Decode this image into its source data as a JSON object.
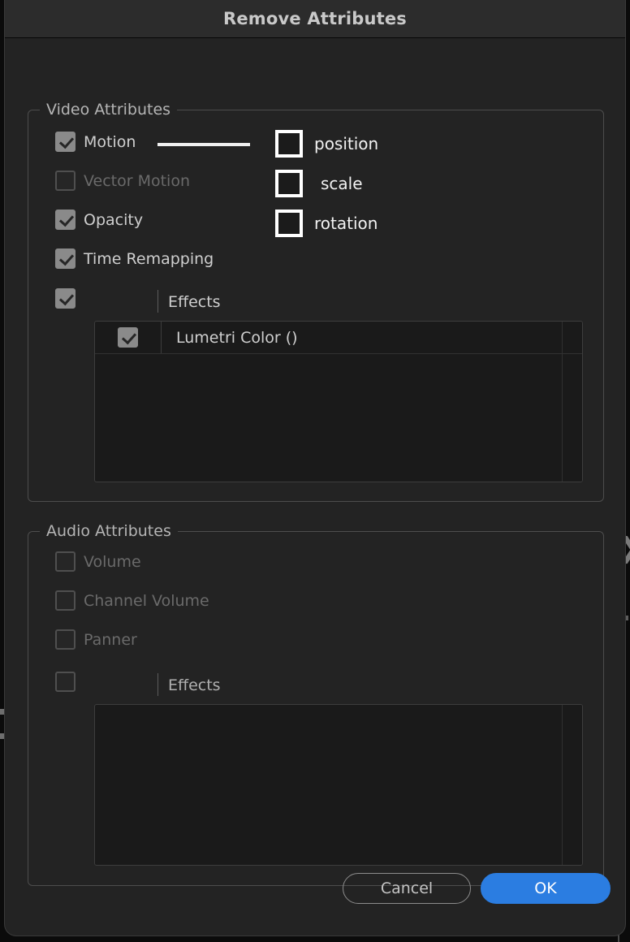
{
  "window": {
    "title": "Remove Attributes"
  },
  "video_group": {
    "legend": "Video Attributes",
    "attributes": [
      {
        "label": "Motion",
        "state": "checked",
        "enabled": true
      },
      {
        "label": "Vector Motion",
        "state": "unchecked",
        "enabled": false
      },
      {
        "label": "Opacity",
        "state": "checked",
        "enabled": true
      },
      {
        "label": "Time Remapping",
        "state": "checked",
        "enabled": true
      }
    ],
    "motion_options": [
      {
        "label": "position",
        "state": "unchecked"
      },
      {
        "label": "scale",
        "state": "unchecked"
      },
      {
        "label": "rotation",
        "state": "unchecked"
      }
    ],
    "effects": {
      "label": "Effects",
      "state": "checked",
      "items": [
        {
          "label": "Lumetri Color ()",
          "state": "checked"
        }
      ]
    }
  },
  "audio_group": {
    "legend": "Audio Attributes",
    "attributes": [
      {
        "label": "Volume",
        "state": "unchecked",
        "enabled": false
      },
      {
        "label": "Channel Volume",
        "state": "unchecked",
        "enabled": false
      },
      {
        "label": "Panner",
        "state": "unchecked",
        "enabled": false
      }
    ],
    "effects": {
      "label": "Effects",
      "state": "unchecked",
      "items": []
    }
  },
  "footer": {
    "cancel_label": "Cancel",
    "ok_label": "OK"
  },
  "colors": {
    "accent": "#2b7de1",
    "dialog_background": "#232323",
    "titlebar_background": "#2c2c2c",
    "listbox_background": "#1a1a1a",
    "checkbox_checked": "#8a8a8a",
    "checkbox_outline_bright": "#ffffff"
  }
}
